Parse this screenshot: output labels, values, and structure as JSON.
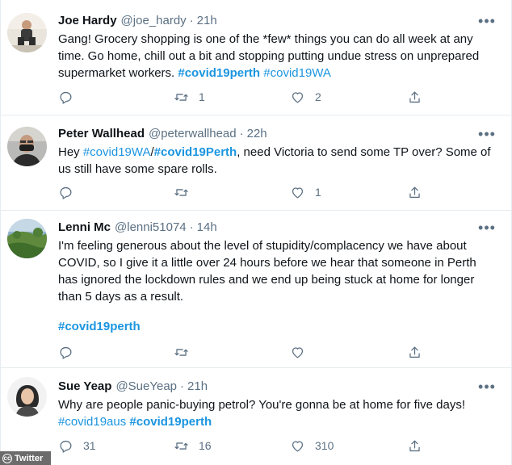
{
  "tweets": [
    {
      "name": "Joe Hardy",
      "handle": "@joe_hardy",
      "time": "21h",
      "text": "Gang! Grocery shopping is one of the *few* things you can do all week at any time. Go home, chill out a bit and stopping putting undue stress on unprepared supermarket workers. ",
      "tag1": "#covid19perth",
      "tag2": "#covid19WA",
      "replies": "",
      "retweets": "1",
      "likes": "2"
    },
    {
      "name": "Peter Wallhead",
      "handle": "@peterwallhead",
      "time": "22h",
      "text_prefix": "Hey ",
      "tag1": "#covid19WA",
      "sep": "/",
      "tag2": "#covid19Perth",
      "text_suffix": ", need Victoria to send some TP over? Some of us still have some spare rolls.",
      "replies": "",
      "retweets": "",
      "likes": "1"
    },
    {
      "name": "Lenni Mc",
      "handle": "@lenni51074",
      "time": "14h",
      "text": "I'm feeling generous about the level of stupidity/complacency we have about COVID, so I give it a little over 24 hours before we hear that someone in Perth has ignored the lockdown rules and we end up being stuck at home for longer than 5 days as a result.",
      "tag1": "#covid19perth",
      "replies": "",
      "retweets": "",
      "likes": ""
    },
    {
      "name": "Sue Yeap",
      "handle": "@SueYeap",
      "time": "21h",
      "text": "Why are people panic-buying petrol? You're gonna be at home for five days!",
      "tag1": "#covid19aus",
      "tag2": "#covid19perth",
      "replies": "31",
      "retweets": "16",
      "likes": "310"
    }
  ],
  "more_glyph": "•••",
  "dot": "·",
  "watermark": {
    "icon": "cc",
    "text": "Twitter"
  },
  "colors": {
    "link": "#1b95e0",
    "secondary": "#5b7083",
    "divider": "#e6ecf0"
  },
  "icons": [
    "reply-icon",
    "retweet-icon",
    "like-icon",
    "share-icon",
    "more-icon"
  ]
}
